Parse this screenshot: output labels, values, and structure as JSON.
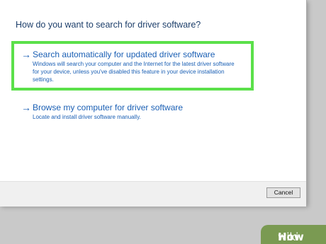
{
  "dialog": {
    "question": "How do you want to search for driver software?",
    "options": [
      {
        "title": "Search automatically for updated driver software",
        "description_lines": [
          "Windows will search your computer and the Internet for the latest driver software",
          "for your device, unless you've disabled this feature in your device installation",
          "settings."
        ],
        "highlighted": true
      },
      {
        "title": "Browse my computer for driver software",
        "description_lines": [
          "Locate and install driver software manually."
        ],
        "highlighted": false
      }
    ],
    "cancel_label": "Cancel"
  },
  "watermark": {
    "part1": "wiki",
    "part2": "How"
  },
  "colors": {
    "link_blue": "#1a5fb4",
    "highlight_green": "#5be04a",
    "question_text": "#1d3f6b",
    "watermark_bg": "#7a9a52"
  },
  "icons": {
    "option_arrow": "arrow-right-icon"
  }
}
